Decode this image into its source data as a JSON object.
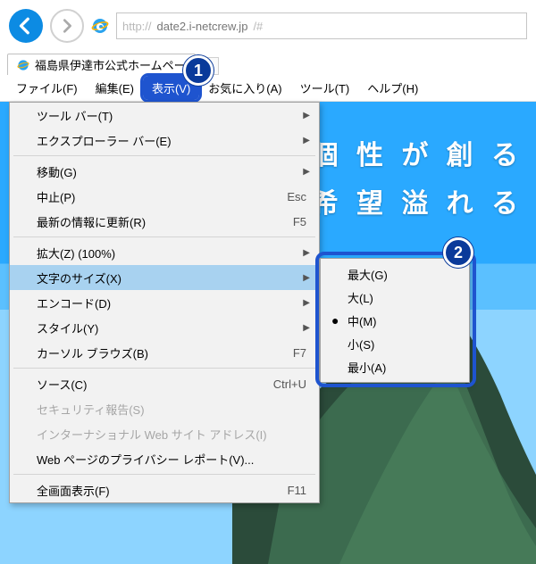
{
  "nav": {
    "url_proto": "http://",
    "url_host": "date2.i-netcrew.jp",
    "url_path": "/#"
  },
  "tab": {
    "title": "福島県伊達市公式ホームペー"
  },
  "menubar": {
    "file": "ファイル(F)",
    "edit": "編集(E)",
    "view": "表示(V)",
    "fav": "お気に入り(A)",
    "tools": "ツール(T)",
    "help": "ヘルプ(H)"
  },
  "view_menu": {
    "toolbars": "ツール バー(T)",
    "explorer": "エクスプローラー バー(E)",
    "goto": "移動(G)",
    "stop": "中止(P)",
    "stop_key": "Esc",
    "refresh": "最新の情報に更新(R)",
    "refresh_key": "F5",
    "zoom": "拡大(Z) (100%)",
    "textsize": "文字のサイズ(X)",
    "encoding": "エンコード(D)",
    "style": "スタイル(Y)",
    "caret": "カーソル ブラウズ(B)",
    "caret_key": "F7",
    "source": "ソース(C)",
    "source_key": "Ctrl+U",
    "security": "セキュリティ報告(S)",
    "idn": "インターナショナル Web サイト アドレス(I)",
    "privacy": "Web ページのプライバシー レポート(V)...",
    "fullscreen": "全画面表示(F)",
    "full_key": "F11"
  },
  "text_sizes": {
    "largest": "最大(G)",
    "larger": "大(L)",
    "medium": "中(M)",
    "smaller": "小(S)",
    "smallest": "最小(A)"
  },
  "hero": {
    "line1": "個 性 が 創 る",
    "line2": "希 望 溢 れ る"
  },
  "annotations": {
    "one": "1",
    "two": "2"
  }
}
